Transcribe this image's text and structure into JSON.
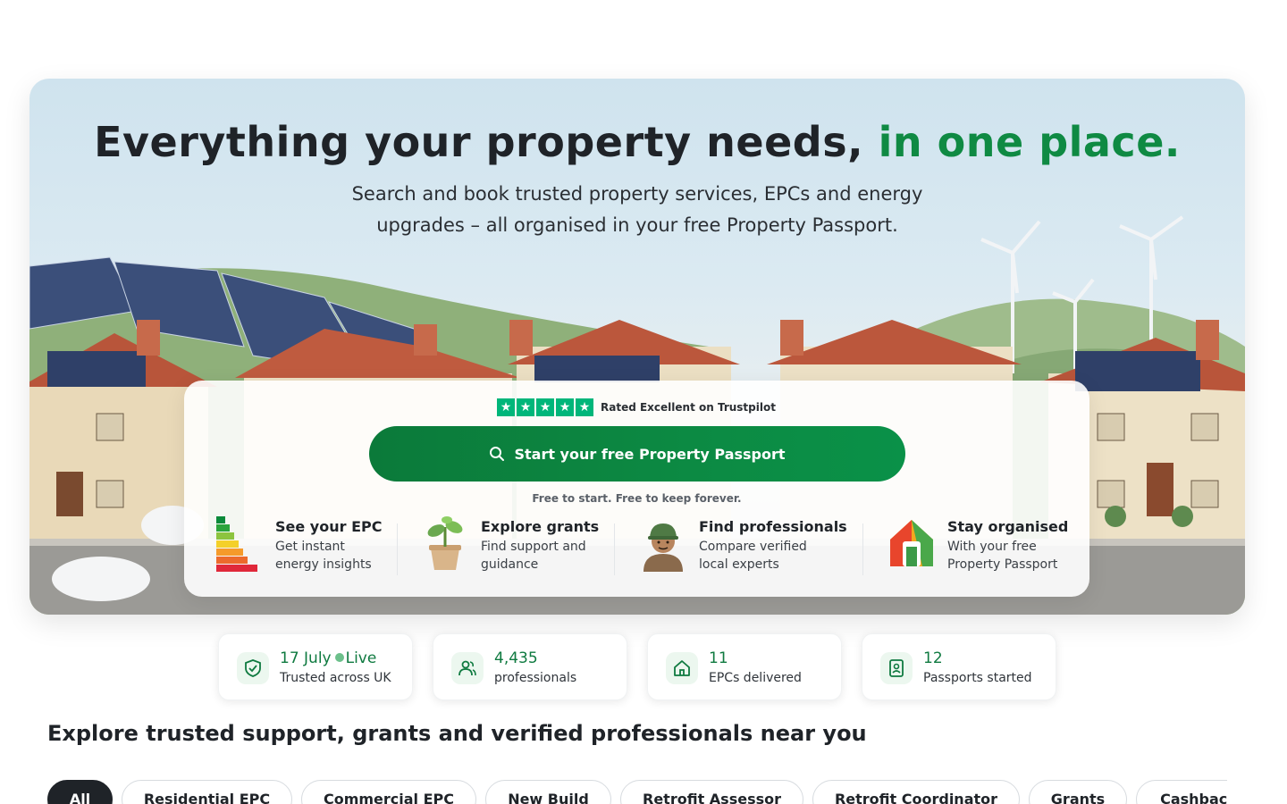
{
  "hero": {
    "title_main": "Everything your property needs, ",
    "title_accent": "in one place.",
    "subtitle": "Search and book trusted property services, EPCs and energy upgrades – all organised in your free Property Passport."
  },
  "card": {
    "trust_text": "Rated Excellent on Trustpilot",
    "star_glyph": "★",
    "cta_label": "Start your free Property Passport",
    "cta_note": "Free to start. Free to keep forever.",
    "features": [
      {
        "title": "See your EPC",
        "desc": "Get instant energy insights",
        "icon": "epc-rating-chart-icon"
      },
      {
        "title": "Explore grants",
        "desc": "Find support and guidance",
        "icon": "plant-pot-icon"
      },
      {
        "title": "Find professionals",
        "desc": "Compare verified local experts",
        "icon": "professional-avatar-icon"
      },
      {
        "title": "Stay organised",
        "desc": "With your free Property Passport",
        "icon": "house-passport-icon"
      }
    ]
  },
  "stats": [
    {
      "value": "17 July",
      "live": "Live",
      "label": "Trusted across UK",
      "icon": "shield-check-icon"
    },
    {
      "value": "4,435",
      "label": "professionals",
      "icon": "users-icon"
    },
    {
      "value": "11",
      "label": "EPCs delivered",
      "icon": "home-icon"
    },
    {
      "value": "12",
      "label": "Passports started",
      "icon": "passport-icon"
    }
  ],
  "section_title": "Explore trusted support, grants and verified professionals near you",
  "chips": [
    "All",
    "Residential EPC",
    "Commercial EPC",
    "New Build",
    "Retrofit Assessor",
    "Retrofit Coordinator",
    "Grants",
    "Cashback"
  ],
  "colors": {
    "accent": "#0f8a43",
    "trustpilot": "#00b67a",
    "chip_active": "#1f2328"
  }
}
